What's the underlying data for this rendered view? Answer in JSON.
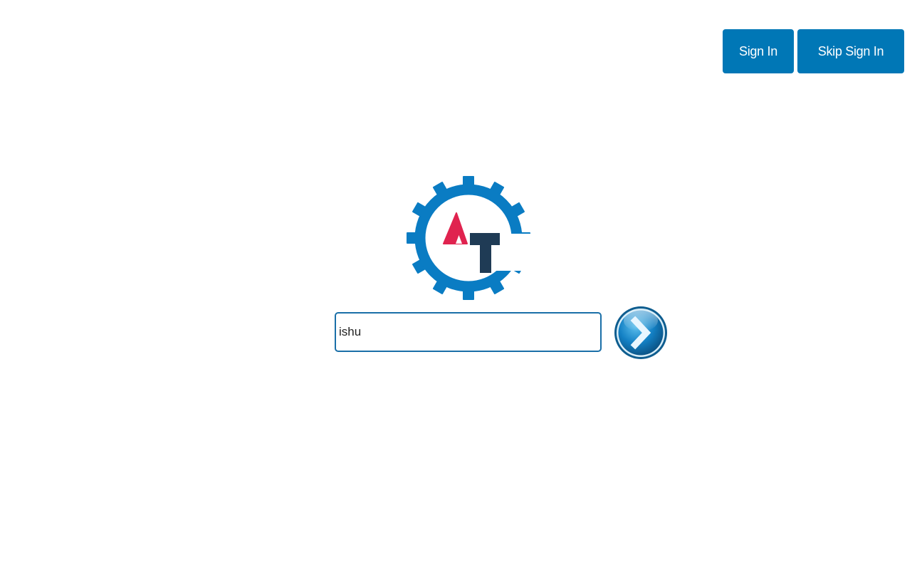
{
  "header": {
    "sign_in_label": "Sign In",
    "skip_sign_in_label": "Skip Sign In"
  },
  "logo": {
    "icon": "gear-logo-icon",
    "colors": {
      "gear": "#0a7cc3",
      "triangle": "#e0234f",
      "letter": "#1f3b55"
    }
  },
  "search": {
    "value": "ishu",
    "placeholder": ""
  },
  "go_button": {
    "icon": "chevron-right-icon",
    "color": "#0d6fa8"
  },
  "colors": {
    "accent": "#0077b6",
    "background": "#ffffff"
  }
}
